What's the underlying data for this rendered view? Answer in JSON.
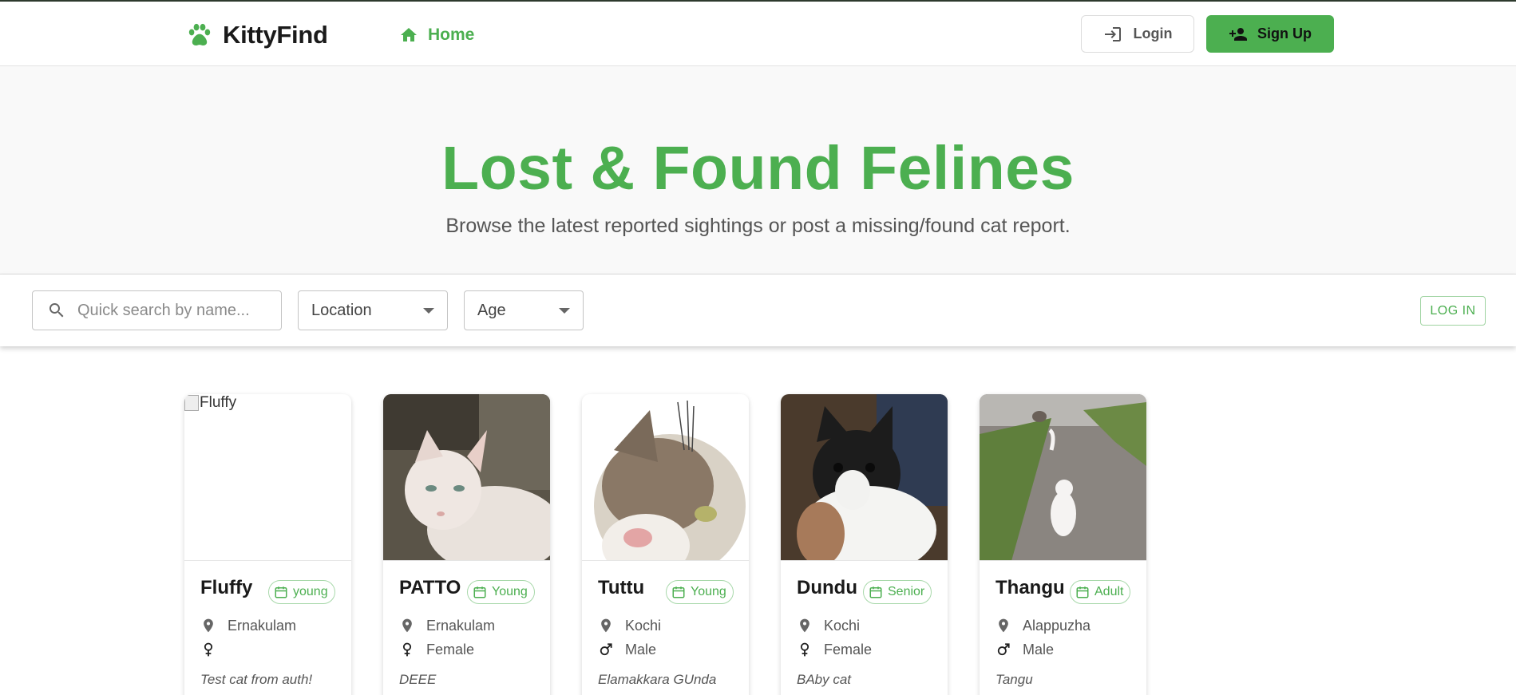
{
  "app": {
    "name": "KittyFind"
  },
  "nav": {
    "home_label": "Home"
  },
  "auth": {
    "login_label": "Login",
    "signup_label": "Sign Up"
  },
  "hero": {
    "title": "Lost & Found Felines",
    "subtitle": "Browse the latest reported sightings or post a missing/found cat report."
  },
  "filters": {
    "search_placeholder": "Quick search by name...",
    "location_label": "Location",
    "age_label": "Age",
    "login_small_label": "LOG IN"
  },
  "cats": [
    {
      "name": "Fluffy",
      "age": "young",
      "location": "Ernakulam",
      "gender": "",
      "gender_icon": "female-icon",
      "description": "Test cat from auth!",
      "image_alt": "Fluffy",
      "image_missing": true
    },
    {
      "name": "PATTO",
      "age": "Young",
      "location": "Ernakulam",
      "gender": "Female",
      "gender_icon": "female-icon",
      "description": "DEEE",
      "image_alt": "PATTO",
      "image_missing": false
    },
    {
      "name": "Tuttu",
      "age": "Young",
      "location": "Kochi",
      "gender": "Male",
      "gender_icon": "male-icon",
      "description": "Elamakkara GUnda",
      "image_alt": "Tuttu",
      "image_missing": false
    },
    {
      "name": "Dundu",
      "age": "Senior",
      "location": "Kochi",
      "gender": "Female",
      "gender_icon": "female-icon",
      "description": "BAby cat",
      "image_alt": "Dundu",
      "image_missing": false
    },
    {
      "name": "Thangu",
      "age": "Adult",
      "location": "Alappuzha",
      "gender": "Male",
      "gender_icon": "male-icon",
      "description": "Tangu",
      "image_alt": "Thangu",
      "image_missing": false
    }
  ],
  "colors": {
    "accent": "#4caf50",
    "text": "#1a1a1a",
    "muted": "#555555"
  }
}
